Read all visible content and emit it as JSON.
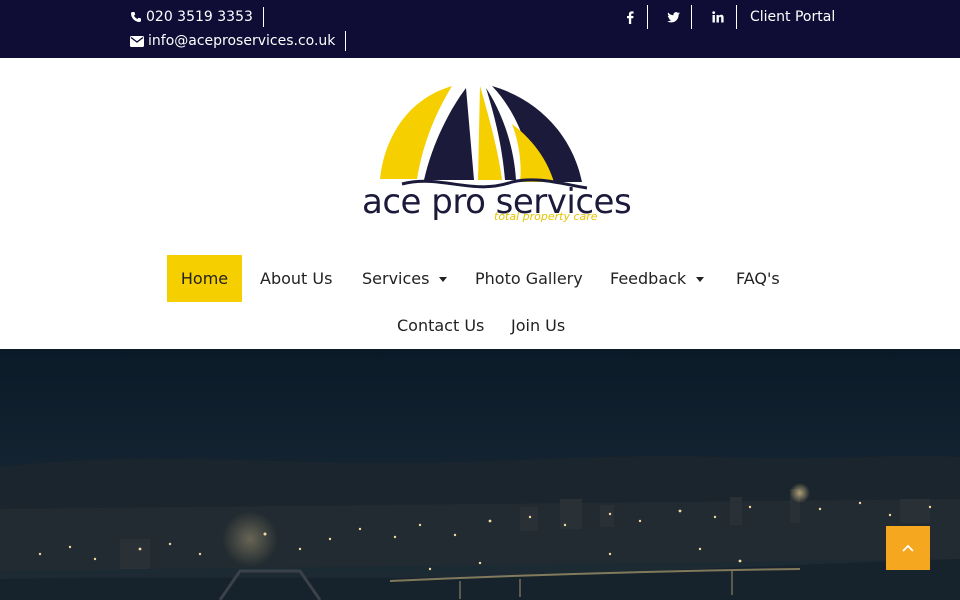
{
  "topbar": {
    "phone": "020 3519 3353",
    "email": "info@aceproservices.co.uk",
    "client_portal": "Client Portal",
    "social": [
      "facebook-icon",
      "twitter-icon",
      "linkedin-icon"
    ],
    "background": "#0f0c35"
  },
  "logo": {
    "text": "ace pro services",
    "tagline": "total property care",
    "colors": {
      "navy": "#1b1a3a",
      "yellow": "#f5cf00"
    }
  },
  "nav": {
    "items": [
      {
        "label": "Home",
        "active": true
      },
      {
        "label": "About Us"
      },
      {
        "label": "Services",
        "dropdown": true
      },
      {
        "label": "Photo Gallery"
      },
      {
        "label": "Feedback",
        "dropdown": true
      },
      {
        "label": "FAQ's"
      },
      {
        "label": "Contact Us"
      },
      {
        "label": "Join Us"
      }
    ],
    "active_color": "#f5cf00"
  },
  "hero": {
    "scene": "night city skyline"
  },
  "back_to_top": {
    "icon": "chevron-up-icon",
    "color": "#f5a81f"
  }
}
